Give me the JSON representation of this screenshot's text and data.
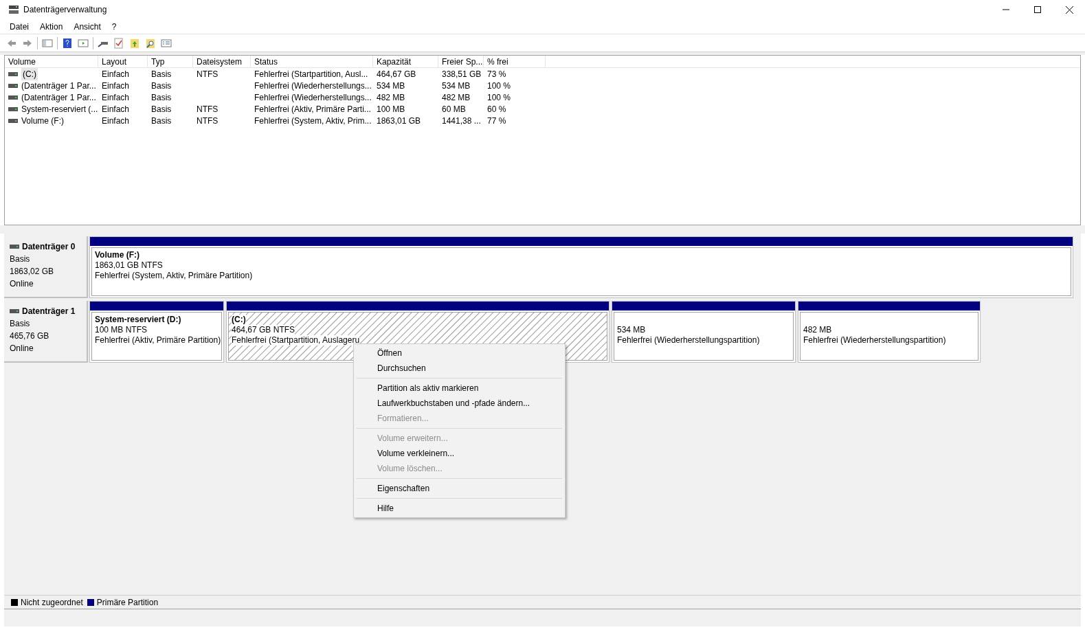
{
  "window": {
    "title": "Datenträgerverwaltung"
  },
  "menu": [
    "Datei",
    "Aktion",
    "Ansicht",
    "?"
  ],
  "table": {
    "columns": [
      "Volume",
      "Layout",
      "Typ",
      "Dateisystem",
      "Status",
      "Kapazität",
      "Freier Sp...",
      "% frei"
    ],
    "rows": [
      {
        "selected": true,
        "cells": [
          "(C:)",
          "Einfach",
          "Basis",
          "NTFS",
          "Fehlerfrei (Startpartition, Ausl...",
          "464,67 GB",
          "338,51 GB",
          "73 %"
        ]
      },
      {
        "selected": false,
        "cells": [
          "(Datenträger 1 Par...",
          "Einfach",
          "Basis",
          "",
          "Fehlerfrei (Wiederherstellungs...",
          "534 MB",
          "534 MB",
          "100 %"
        ]
      },
      {
        "selected": false,
        "cells": [
          "(Datenträger 1 Par...",
          "Einfach",
          "Basis",
          "",
          "Fehlerfrei (Wiederherstellungs...",
          "482 MB",
          "482 MB",
          "100 %"
        ]
      },
      {
        "selected": false,
        "cells": [
          "System-reserviert (...",
          "Einfach",
          "Basis",
          "NTFS",
          "Fehlerfrei (Aktiv, Primäre Parti...",
          "100 MB",
          "60 MB",
          "60 %"
        ]
      },
      {
        "selected": false,
        "cells": [
          "Volume (F:)",
          "Einfach",
          "Basis",
          "NTFS",
          "Fehlerfrei (System, Aktiv, Prim...",
          "1863,01 GB",
          "1441,38 ...",
          "77 %"
        ]
      }
    ]
  },
  "disks": [
    {
      "name": "Datenträger 0",
      "type": "Basis",
      "size": "1863,02 GB",
      "state": "Online",
      "partitions": [
        {
          "name": "Volume  (F:)",
          "size": "1863,01 GB NTFS",
          "status": "Fehlerfrei (System, Aktiv, Primäre Partition)",
          "selected": false
        }
      ]
    },
    {
      "name": "Datenträger 1",
      "type": "Basis",
      "size": "465,76 GB",
      "state": "Online",
      "partitions": [
        {
          "name": "System-reserviert  (D:)",
          "size": "100 MB NTFS",
          "status": "Fehlerfrei (Aktiv, Primäre Partition)",
          "selected": false
        },
        {
          "name": "(C:)",
          "size": "464,67 GB NTFS",
          "status": "Fehlerfrei (Startpartition, Auslageru",
          "selected": true
        },
        {
          "size": "534 MB",
          "status": "Fehlerfrei (Wiederherstellungspartition)",
          "selected": false
        },
        {
          "size": "482 MB",
          "status": "Fehlerfrei (Wiederherstellungspartition)",
          "selected": false
        }
      ]
    }
  ],
  "context_menu": [
    {
      "kind": "item",
      "label": "Öffnen",
      "disabled": false
    },
    {
      "kind": "item",
      "label": "Durchsuchen",
      "disabled": false
    },
    {
      "kind": "separator"
    },
    {
      "kind": "item",
      "label": "Partition als aktiv markieren",
      "disabled": false
    },
    {
      "kind": "item",
      "label": "Laufwerkbuchstaben und -pfade ändern...",
      "disabled": false
    },
    {
      "kind": "item",
      "label": "Formatieren...",
      "disabled": true
    },
    {
      "kind": "separator"
    },
    {
      "kind": "item",
      "label": "Volume erweitern...",
      "disabled": true
    },
    {
      "kind": "item",
      "label": "Volume verkleinern...",
      "disabled": false
    },
    {
      "kind": "item",
      "label": "Volume löschen...",
      "disabled": true
    },
    {
      "kind": "separator"
    },
    {
      "kind": "item",
      "label": "Eigenschaften",
      "disabled": false
    },
    {
      "kind": "separator"
    },
    {
      "kind": "item",
      "label": "Hilfe",
      "disabled": false
    }
  ],
  "legend": [
    {
      "label": "Nicht zugeordnet",
      "color": "#000000"
    },
    {
      "label": "Primäre Partition",
      "color": "#000080"
    }
  ]
}
